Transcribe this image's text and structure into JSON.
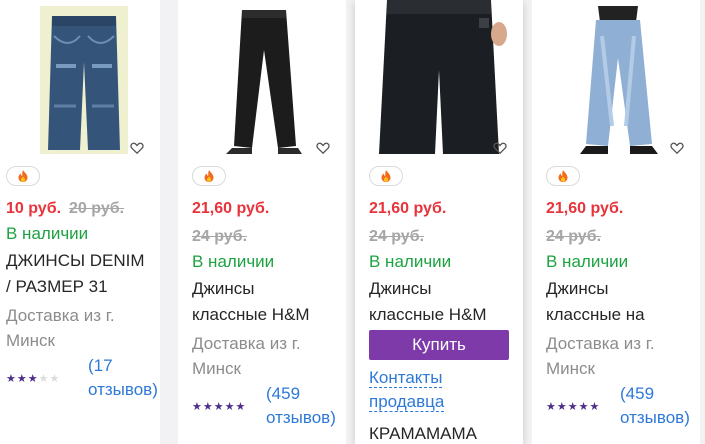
{
  "products": [
    {
      "price": "10 руб.",
      "old_price": "20 руб.",
      "stock": "В наличии",
      "title_lines": [
        "ДЖИНСЫ DENIM",
        "/ РАЗМЕР 31"
      ],
      "delivery_lines": [
        "Доставка из г.",
        "Минск"
      ],
      "rating": 3,
      "review_lines": [
        "(17",
        "отзывов)"
      ]
    },
    {
      "price": "21,60 руб.",
      "old_price": "24 руб.",
      "stock": "В наличии",
      "title_lines": [
        "Джинсы",
        "классные H&M"
      ],
      "delivery_lines": [
        "Доставка из г.",
        "Минск"
      ],
      "rating": 5,
      "review_lines": [
        "(459",
        "отзывов)"
      ]
    },
    {
      "price": "21,60 руб.",
      "old_price": "24 руб.",
      "stock": "В наличии",
      "title_lines": [
        "Джинсы",
        "классные H&M"
      ],
      "buy_label": "Купить",
      "contacts_lines": [
        "Контакты",
        "продавца"
      ],
      "seller": "КРАМАМАМА"
    },
    {
      "price": "21,60 руб.",
      "old_price": "24 руб.",
      "stock": "В наличии",
      "title_lines": [
        "Джинсы",
        "классные на"
      ],
      "delivery_lines": [
        "Доставка из г.",
        "Минск"
      ],
      "rating": 5,
      "review_lines": [
        "(459",
        "отзывов)"
      ]
    }
  ],
  "icons": {
    "favorite": "heart-icon",
    "badge": "fire-icon",
    "rating": "star-icon"
  },
  "colors": {
    "price": "#e8333a",
    "in_stock": "#1da241",
    "buy_button": "#7d3aa8",
    "link": "#2e79d8",
    "stars": "#4d2e8a"
  }
}
